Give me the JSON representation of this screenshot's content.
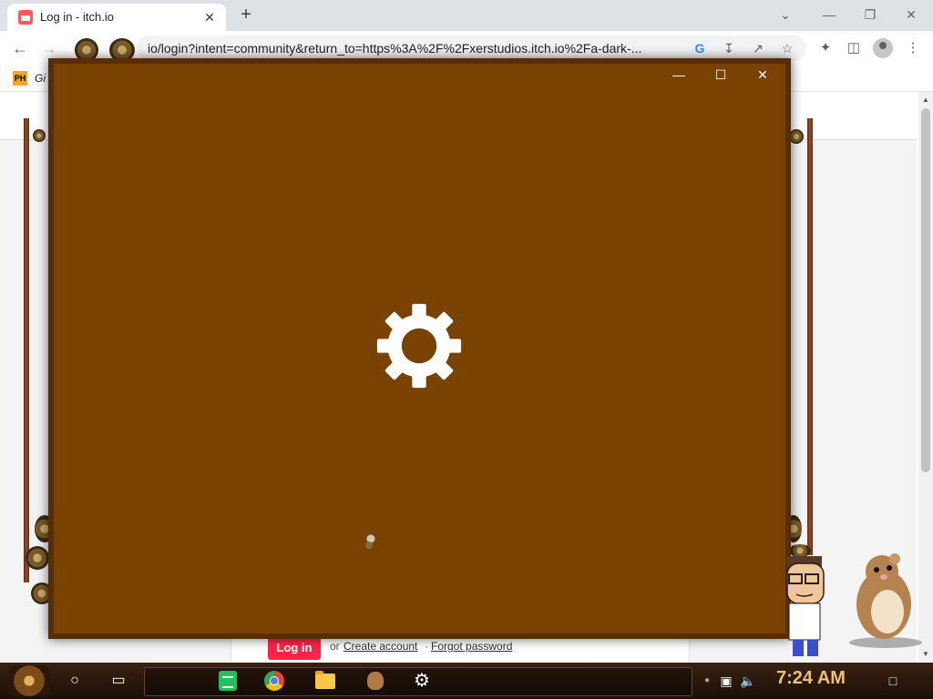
{
  "browser": {
    "tab_title": "Log in - itch.io",
    "tab_close": "✕",
    "new_tab": "+",
    "url": "io/login?intent=community&return_to=https%3A%2F%2Fxerstudios.itch.io%2Fa-dark-...",
    "bookmark_label": "Gi",
    "bookmark_icon_text": "PH",
    "window_controls": {
      "collapse": "⌄",
      "minimize": "—",
      "restore": "❐",
      "close": "✕"
    }
  },
  "page": {
    "login_button": "Log in",
    "or_text": "or",
    "create_account": "Create account",
    "separator": "·",
    "forgot_password": "Forgot password"
  },
  "overlay_window": {
    "background_color": "#7a4201",
    "controls": {
      "minimize": "—",
      "maximize": "☐",
      "close": "✕"
    },
    "icon": "gear-icon"
  },
  "taskbar": {
    "clock": "7:24 AM",
    "icons": [
      "cortana-icon",
      "task-view-icon",
      "sheets-icon",
      "chrome-icon",
      "file-explorer-icon",
      "hamster-app-icon",
      "settings-icon"
    ]
  }
}
